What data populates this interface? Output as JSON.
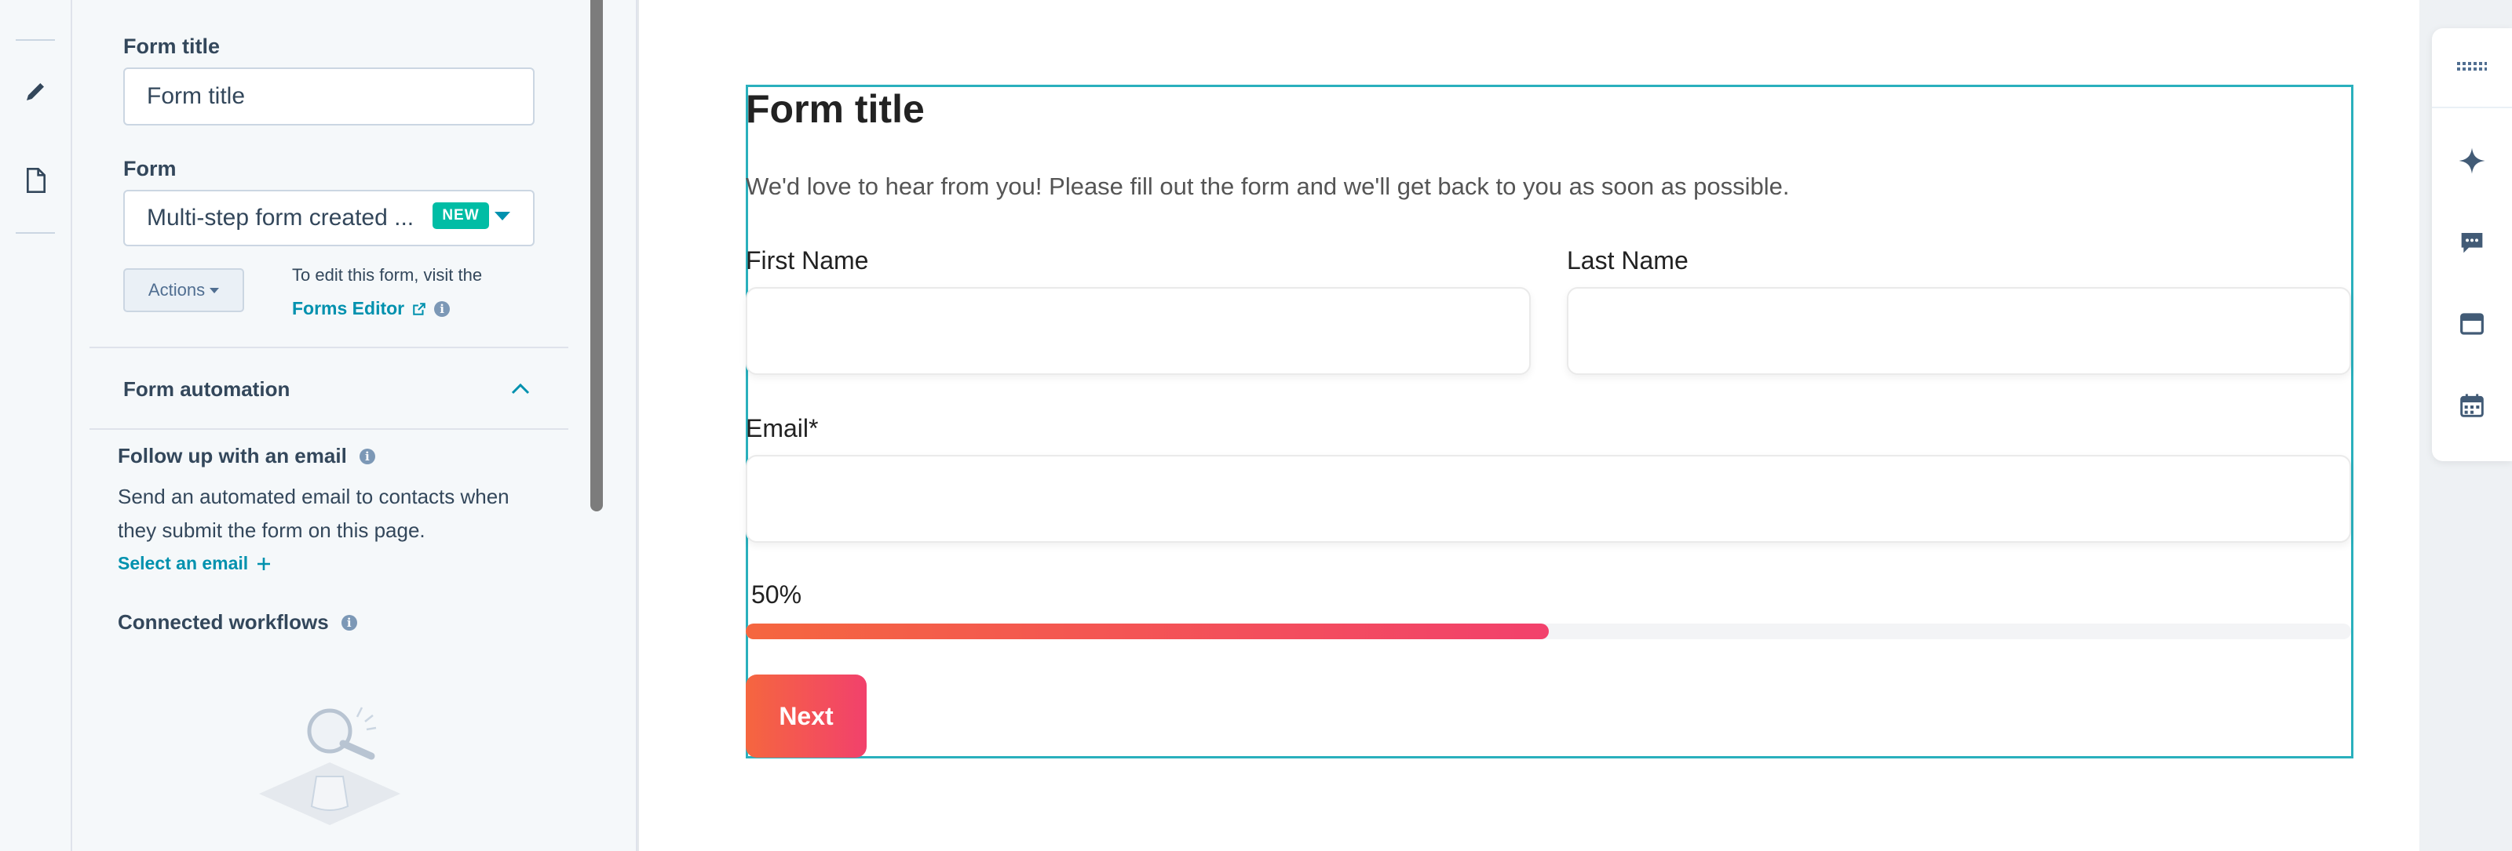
{
  "sidebar": {
    "form_title_label": "Form title",
    "form_title_value": "Form title",
    "form_label": "Form",
    "form_select_value": "Multi-step form created ...",
    "form_badge": "NEW",
    "actions_label": "Actions",
    "edit_note": "To edit this form, visit the",
    "forms_editor_link": "Forms Editor",
    "automation_heading": "Form automation",
    "follow_up_heading": "Follow up with an email",
    "follow_up_text_1": "Send an automated email to contacts when",
    "follow_up_text_2": "they submit the form on this page.",
    "select_email_link": "Select an email",
    "connected_workflows": "Connected workflows"
  },
  "form": {
    "title": "Form title",
    "description": "We'd love to hear from you! Please fill out the form and we'll get back to you as soon as possible.",
    "first_name_label": "First Name",
    "last_name_label": "Last Name",
    "email_label": "Email*",
    "progress_label": "50%",
    "progress_value": 0.5,
    "next_button": "Next"
  },
  "icons": {
    "rail": [
      "pencil-icon",
      "page-icon"
    ],
    "toolbar": [
      "grid-icon",
      "sparkle-icon",
      "comment-icon",
      "window-icon",
      "calendar-icon"
    ]
  },
  "colors": {
    "accent": "#0091ae",
    "badge": "#00bda5",
    "selection": "#2ab0bd",
    "gradient_start": "#f5663f",
    "gradient_end": "#f2416c"
  }
}
